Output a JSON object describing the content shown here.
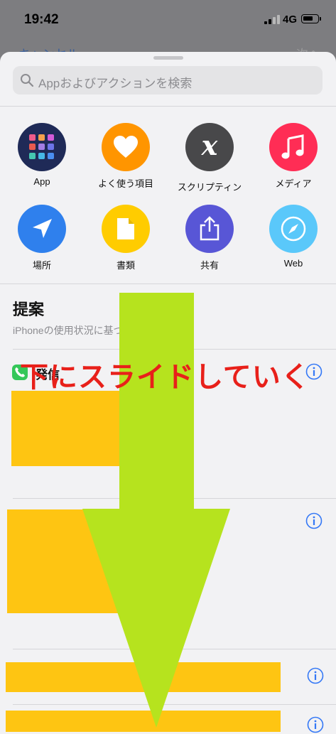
{
  "status_bar": {
    "time": "19:42",
    "network": "4G"
  },
  "background_nav": {
    "left_text": "キャンセル",
    "right_text": "次へ"
  },
  "search": {
    "placeholder": "Appおよびアクションを検索"
  },
  "categories": [
    {
      "label": "App",
      "icon": "app-grid-icon",
      "color": "#1f2a57"
    },
    {
      "label": "よく使う項目",
      "icon": "heart-icon",
      "color": "#ff9500"
    },
    {
      "label": "スクリプティン",
      "icon": "script-x-icon",
      "color": "#48484a"
    },
    {
      "label": "メディア",
      "icon": "music-note-icon",
      "color": "#ff2d55"
    },
    {
      "label": "場所",
      "icon": "location-arrow-icon",
      "color": "#2f80ed"
    },
    {
      "label": "書類",
      "icon": "document-icon",
      "color": "#ffcc00"
    },
    {
      "label": "共有",
      "icon": "share-icon",
      "color": "#5856d6"
    },
    {
      "label": "Web",
      "icon": "compass-icon",
      "color": "#5ac8fa"
    }
  ],
  "suggestions": {
    "title": "提案",
    "subtitle": "iPhoneの使用状況に基づいた提案です。",
    "first_row_label": "発信"
  },
  "overlay": {
    "instruction": "下にスライドしていく",
    "arrow_color": "#b6e31e",
    "highlight_color": "#fec512"
  }
}
